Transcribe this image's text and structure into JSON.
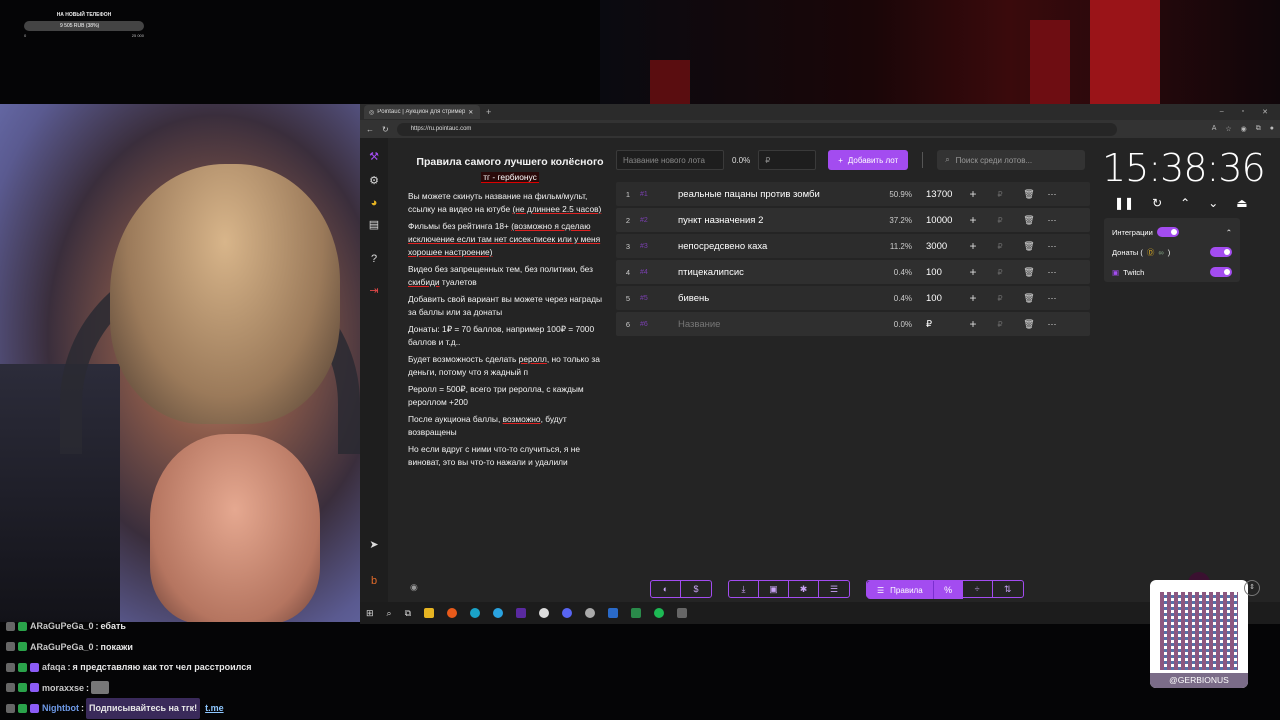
{
  "goal": {
    "title": "НА НОВЫЙ ТЕЛЕФОН",
    "progress_text": "9 505 RUB (38%)",
    "progress": 0.38,
    "min": "0",
    "max": "25 000"
  },
  "browser": {
    "tab_title": "Pointauc | Аукцион для стримеров",
    "url": "https://ru.pointauc.com"
  },
  "rules": {
    "title": "Правила самого лучшего колёсного",
    "subtitle": "тг - гербионус",
    "paragraphs": [
      {
        "pre": "Вы можете скинуть название на фильм/мульт, ссылку на видео на ютубе ",
        "u": "(не длиннее 2.5 часов)",
        "post": ""
      },
      {
        "pre": "Фильмы без рейтинга 18+ ",
        "u": "(возможно я сделаю исключение если там нет сисек-писек или у меня хорошее настроение)",
        "post": ""
      },
      {
        "pre": "Видео без запрещенных тем, без политики, без ",
        "u": "скибиди",
        "post": " туалетов"
      },
      {
        "pre": "Добавить свой вариант вы можете через награды за баллы или за донаты",
        "u": "",
        "post": ""
      },
      {
        "pre": "Донаты: 1₽ = 70 баллов, например 100₽ = 7000 баллов и т.д..",
        "u": "",
        "post": ""
      },
      {
        "pre": "Будет возможность сделать ",
        "u": "реролл",
        "post": ", но только за деньги, потому что я жадный п"
      },
      {
        "pre": "Реролл = 500₽, всего три реролла, с каждым рероллом +200",
        "u": "",
        "post": ""
      },
      {
        "pre": "После аукциона баллы, ",
        "u": "возможно",
        "post": ", будут возвращены"
      },
      {
        "pre": "Но если вдруг с ними что-то случиться, я не виноват, это вы что-то нажали и удалили",
        "u": "",
        "post": ""
      }
    ]
  },
  "lot_controls": {
    "name_placeholder": "Название нового лота",
    "percent": "0.0%",
    "amount_placeholder": "₽",
    "add_label": "Добавить лот",
    "search_placeholder": "Поиск среди лотов..."
  },
  "lots": [
    {
      "idx": "1",
      "tag": "#1",
      "name": "реальные пацаны против зомби",
      "pct": "50.9%",
      "amount": "13700",
      "rub": "₽"
    },
    {
      "idx": "2",
      "tag": "#2",
      "name": "пункт назначения 2",
      "pct": "37.2%",
      "amount": "10000",
      "rub": "₽"
    },
    {
      "idx": "3",
      "tag": "#3",
      "name": "непосредсвено каха",
      "pct": "11.2%",
      "amount": "3000",
      "rub": "₽"
    },
    {
      "idx": "4",
      "tag": "#4",
      "name": "птицекалипсис",
      "pct": "0.4%",
      "amount": "100",
      "rub": "₽"
    },
    {
      "idx": "5",
      "tag": "#5",
      "name": "бивень",
      "pct": "0.4%",
      "amount": "100",
      "rub": "₽"
    },
    {
      "idx": "6",
      "tag": "#6",
      "name": "Название",
      "pct": "0.0%",
      "amount": "₽",
      "rub": "₽"
    }
  ],
  "timer": {
    "value": "15:38:36"
  },
  "integrations": {
    "title": "Интеграции",
    "donations": "Донаты (",
    "donations_end": ")",
    "twitch": "Twitch"
  },
  "bottombar": {
    "rules_label": "Правила",
    "pct_label": "%"
  },
  "chat": [
    {
      "user": "ARaGuPeGa_0",
      "msg": "ебать"
    },
    {
      "user": "ARaGuPeGa_0",
      "msg": "покажи"
    },
    {
      "user": "afaqa",
      "msg": "я представляю как тот чел расстроился"
    },
    {
      "user": "moraxxse",
      "msg": ""
    },
    {
      "user": "Nightbot",
      "msg": "Подписывайтесь на тгк!",
      "link": "t.me"
    }
  ],
  "qr": {
    "label": "@GERBIONUS"
  },
  "colors": {
    "accent": "#a34cf0",
    "bg": "#242424"
  }
}
